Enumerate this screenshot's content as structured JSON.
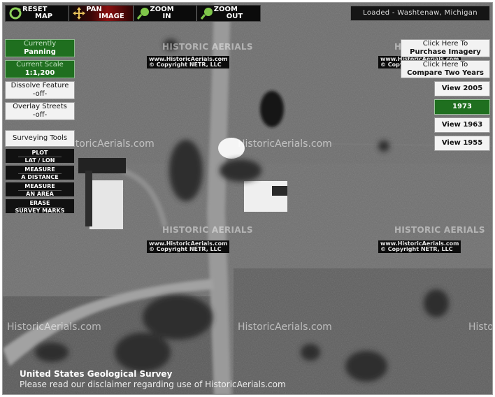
{
  "toolbar": {
    "reset": {
      "line1": "RESET",
      "line2": "MAP",
      "icon": "reset-icon"
    },
    "pan": {
      "line1": "PAN",
      "line2": "IMAGE",
      "icon": "pan-icon"
    },
    "zoom_in": {
      "line1": "ZOOM",
      "line2": "IN",
      "icon": "zoom-in-icon"
    },
    "zoom_out": {
      "line1": "ZOOM",
      "line2": "OUT",
      "icon": "zoom-out-icon"
    }
  },
  "status": "Loaded - Washtenaw, Michigan",
  "left_panel": {
    "currently": {
      "caption": "Currently",
      "value": "Panning"
    },
    "scale": {
      "caption": "Current Scale",
      "value": "1:1,200"
    },
    "dissolve": {
      "caption": "Dissolve Feature",
      "value": "-off-"
    },
    "overlay": {
      "caption": "Overlay Streets",
      "value": "-off-"
    },
    "surveying_title": "Surveying Tools",
    "tools": [
      {
        "line1": "PLOT",
        "line2": "LAT / LON"
      },
      {
        "line1": "MEASURE",
        "line2": "A DISTANCE"
      },
      {
        "line1": "MEASURE",
        "line2": "AN AREA"
      },
      {
        "line1": "ERASE",
        "line2": "SURVEY MARKS"
      }
    ]
  },
  "right_panel": {
    "purchase": {
      "line1": "Click Here To",
      "line2": "Purchase Imagery"
    },
    "compare": {
      "line1": "Click Here To",
      "line2": "Compare Two Years"
    },
    "years": [
      {
        "label": "View 2005",
        "selected": false
      },
      {
        "label": "1973",
        "selected": true
      },
      {
        "label": "View 1963",
        "selected": false
      },
      {
        "label": "View 1955",
        "selected": false
      }
    ]
  },
  "watermarks": {
    "logo_text": "HISTORIC AERIALS",
    "site_text": "HistoricAerials.com",
    "copy_line1": "www.HistoricAerials.com",
    "copy_line2": "© Copyright NETR, LLC"
  },
  "caption": {
    "line1": "United States Geological Survey",
    "line2": "Please read our disclaimer regarding use of HistoricAerials.com"
  },
  "colors": {
    "selected_green": "#1f6f1f",
    "toolbar_black": "#0b0b0b"
  }
}
